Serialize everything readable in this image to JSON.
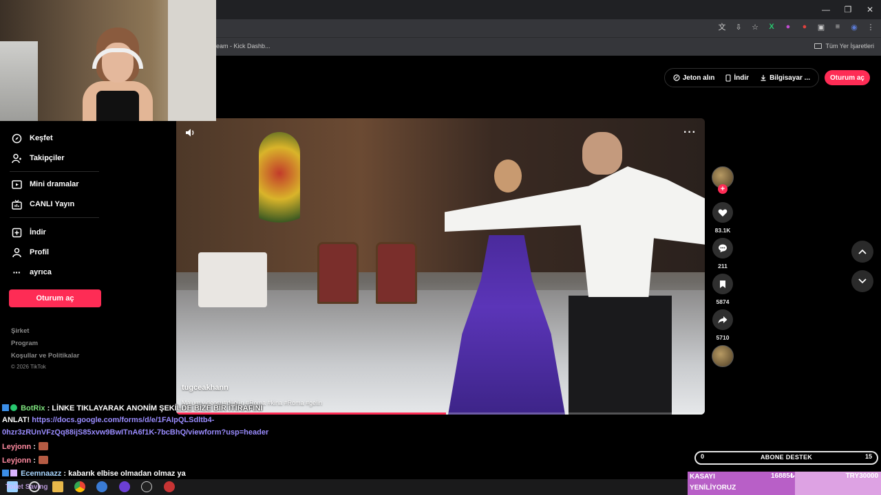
{
  "browser": {
    "window_controls": [
      "—",
      "❐",
      "✕"
    ],
    "bookmark_tab": "eam - Kick Dashb...",
    "bookmarks_folder": "Tüm Yer İşaretleri"
  },
  "header": {
    "coins": "Jeton alın",
    "download": "İndir",
    "computer": "Bilgisayar ...",
    "login": "Oturum aç"
  },
  "sidebar": {
    "items": [
      {
        "label": "Keşfet",
        "icon": "compass-icon"
      },
      {
        "label": "Takipçiler",
        "icon": "followers-icon"
      },
      {
        "label": "Mini dramalar",
        "icon": "film-icon"
      },
      {
        "label": "CANLI Yayın",
        "icon": "live-tv-icon"
      },
      {
        "label": "İndir",
        "icon": "download-plus-icon"
      },
      {
        "label": "Profil",
        "icon": "profile-icon"
      },
      {
        "label": "ayrıca",
        "icon": "more-icon"
      }
    ],
    "login_button": "Oturum aç",
    "footer": [
      "Şirket",
      "Program",
      "Koşullar ve Politikalar"
    ],
    "copyright": "© 2026 TikTok"
  },
  "video": {
    "author": "tugceakhann",
    "description": "Malum videosu#düğün #Roma #kina #Roma #gelin",
    "progress": 0.51
  },
  "actions": {
    "likes": "83.1K",
    "comments": "211",
    "saves": "5874",
    "shares": "5710"
  },
  "chat": {
    "lines": [
      {
        "user": "BotRix",
        "text": " : LİNKE TIKLAYARAK ANONİM ŞEKİLDE BİZE BİR İTİRAFINI"
      },
      {
        "user": "",
        "text": "ANLAT! ",
        "link": "https://docs.google.com/forms/d/e/1FAIpQLSdltb4-"
      },
      {
        "user": "",
        "text": "",
        "link": "0hzr3zRUnVFzQq88ijS85xvw9BwITnA6f1K-7bcBhQ/viewform?usp=header"
      },
      {
        "user": "Leyjonn",
        "text": " :"
      },
      {
        "user": "Leyjonn",
        "text": " :"
      },
      {
        "user": "Ecemnaazz",
        "text": " : kabarık elbise olmadan olmaz ya"
      }
    ]
  },
  "sub_goal": {
    "left": "0",
    "label": "ABONE DESTEK",
    "right": "15"
  },
  "kasa": {
    "line1": "KASAYI",
    "line2": "YENİLİYORUZ",
    "current": "16885₺",
    "goal": "TRY30000",
    "progress": 0.56
  },
  "taskbar": {
    "label": "Toilet Saving"
  },
  "colors": {
    "brand": "#fe2c55",
    "background": "#000000"
  }
}
